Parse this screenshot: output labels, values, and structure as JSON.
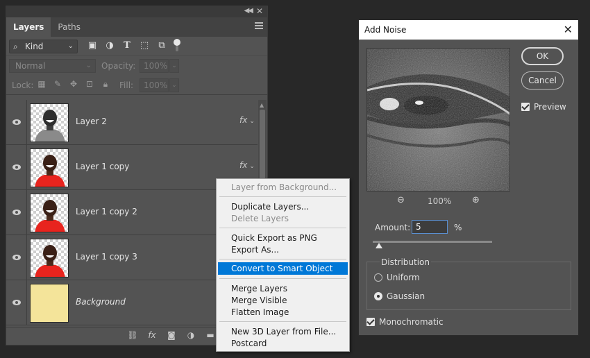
{
  "layers_panel": {
    "tabs": [
      {
        "label": "Layers",
        "active": true
      },
      {
        "label": "Paths",
        "active": false
      }
    ],
    "filter": {
      "kind_label": "Kind",
      "icons": [
        "image-filter-icon",
        "adjustment-filter-icon",
        "type-filter-icon",
        "shape-filter-icon",
        "smart-object-filter-icon"
      ]
    },
    "blend_mode": "Normal",
    "opacity_label": "Opacity:",
    "opacity_value": "100%",
    "lock_label": "Lock:",
    "fill_label": "Fill:",
    "fill_value": "100%",
    "layers": [
      {
        "name": "Layer 2",
        "has_fx": true,
        "fx_label": "fx",
        "shirt_color": "#8a8a8a"
      },
      {
        "name": "Layer 1 copy",
        "has_fx": true,
        "fx_label": "fx",
        "shirt_color": "#e8241e"
      },
      {
        "name": "Layer 1 copy 2",
        "has_fx": false,
        "shirt_color": "#e8241e"
      },
      {
        "name": "Layer 1 copy 3",
        "has_fx": false,
        "shirt_color": "#e8241e"
      },
      {
        "name": "Background",
        "has_fx": false,
        "fill_color": "#f4e49a"
      }
    ]
  },
  "context_menu": {
    "groups": [
      [
        {
          "label": "Layer from Background...",
          "enabled": false
        }
      ],
      [
        {
          "label": "Duplicate Layers...",
          "enabled": true
        },
        {
          "label": "Delete Layers",
          "enabled": false
        }
      ],
      [
        {
          "label": "Quick Export as PNG",
          "enabled": true
        },
        {
          "label": "Export As...",
          "enabled": true
        }
      ],
      [
        {
          "label": "Convert to Smart Object",
          "enabled": true,
          "highlighted": true
        }
      ],
      [
        {
          "label": "Merge Layers",
          "enabled": true
        },
        {
          "label": "Merge Visible",
          "enabled": true
        },
        {
          "label": "Flatten Image",
          "enabled": true
        }
      ],
      [
        {
          "label": "New 3D Layer from File...",
          "enabled": true
        },
        {
          "label": "Postcard",
          "enabled": true
        }
      ]
    ]
  },
  "add_noise": {
    "title": "Add Noise",
    "ok_label": "OK",
    "cancel_label": "Cancel",
    "preview_label": "Preview",
    "preview_checked": true,
    "zoom_value": "100%",
    "amount_label": "Amount:",
    "amount_value": "5",
    "amount_unit": "%",
    "amount_slider_fraction": 0.05,
    "distribution_label": "Distribution",
    "distribution_options": [
      "Uniform",
      "Gaussian"
    ],
    "distribution_selected": "Gaussian",
    "monochromatic_label": "Monochromatic",
    "monochromatic_checked": true
  },
  "colors": {
    "highlight": "#0078d7",
    "panel_bg": "#535353"
  }
}
